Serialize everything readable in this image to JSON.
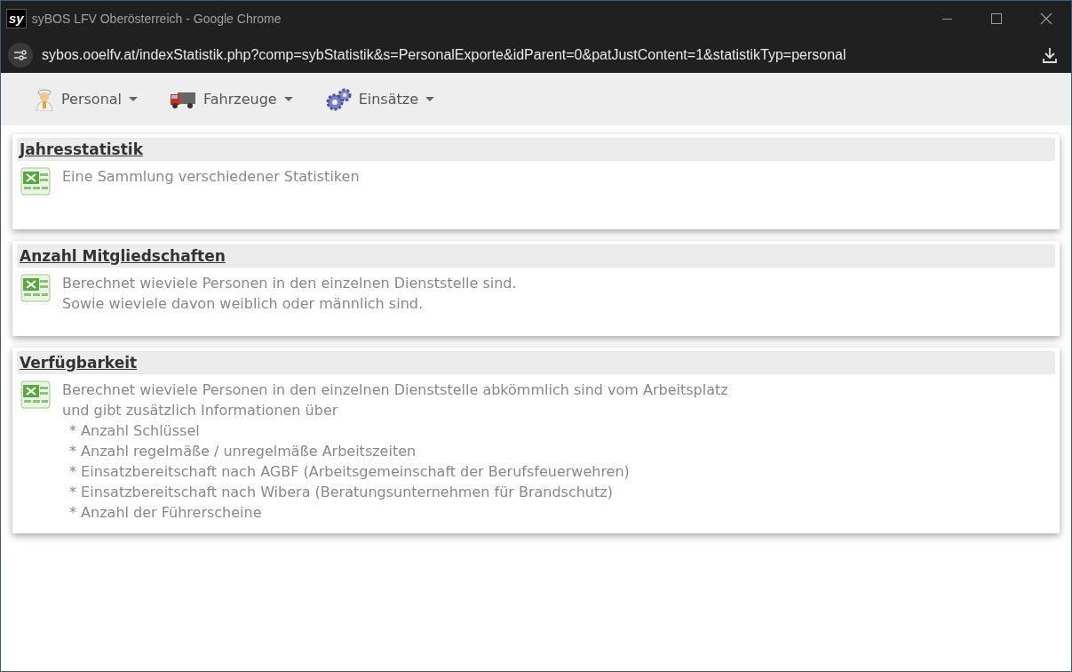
{
  "window": {
    "app_badge": "sy",
    "title": "syBOS LFV Oberösterreich - Google Chrome"
  },
  "address_bar": {
    "url": "sybos.ooelfv.at/indexStatistik.php?comp=sybStatistik&s=PersonalExporte&idParent=0&patJustContent=1&statistikTyp=personal"
  },
  "menu": [
    {
      "label": "Personal",
      "kind": "person"
    },
    {
      "label": "Fahrzeuge",
      "kind": "truck"
    },
    {
      "label": "Einsätze",
      "kind": "gears"
    }
  ],
  "cards": [
    {
      "title": "Jahresstatistik",
      "lines": [
        {
          "kind": "text",
          "text": "Eine Sammlung verschiedener Statistiken"
        }
      ]
    },
    {
      "title": "Anzahl Mitgliedschaften",
      "lines": [
        {
          "kind": "text",
          "text": "Berechnet wieviele Personen in den einzelnen Dienststelle sind."
        },
        {
          "kind": "text",
          "text": "Sowie wieviele davon weiblich oder männlich sind."
        }
      ]
    },
    {
      "title": "Verfügbarkeit",
      "lines": [
        {
          "kind": "text",
          "text": "Berechnet wieviele Personen in den einzelnen Dienststelle abkömmlich sind vom Arbeitsplatz"
        },
        {
          "kind": "text",
          "text": "und gibt zusätzlich Informationen über"
        },
        {
          "kind": "bullet",
          "text": "* Anzahl Schlüssel"
        },
        {
          "kind": "bullet",
          "text": "* Anzahl regelmäße / unregelmäße Arbeitszeiten"
        },
        {
          "kind": "bullet",
          "text": "* Einsatzbereitschaft nach AGBF (Arbeitsgemeinschaft der Berufsfeuerwehren)"
        },
        {
          "kind": "bullet",
          "text": "* Einsatzbereitschaft nach Wibera (Beratungsunternehmen für Brandschutz)"
        },
        {
          "kind": "bullet",
          "text": "* Anzahl der Führerscheine"
        }
      ]
    }
  ]
}
